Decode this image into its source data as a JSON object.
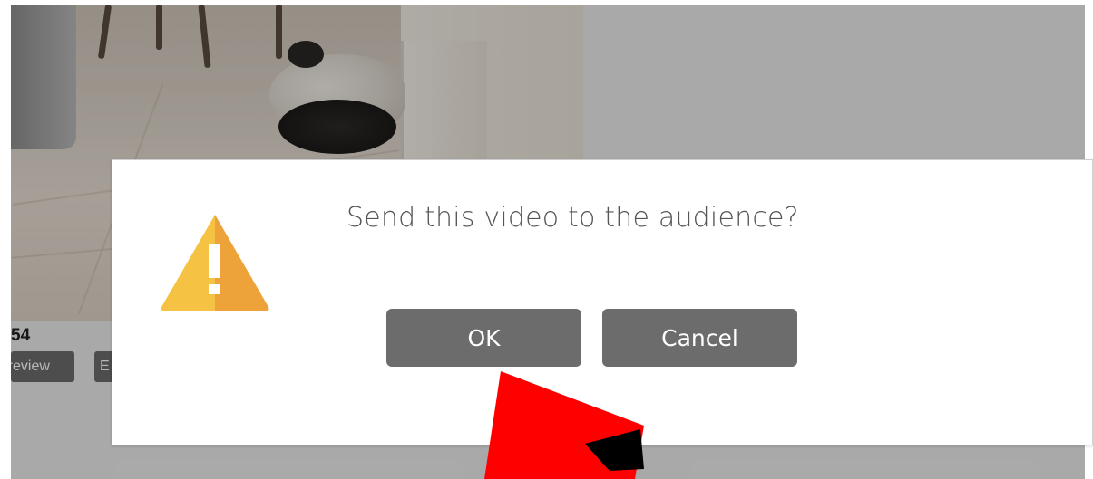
{
  "video": {
    "count_label": "54",
    "preview_label": "Preview",
    "second_label": "E"
  },
  "dialog": {
    "message": "Send this video to the audience?",
    "ok_label": "OK",
    "cancel_label": "Cancel",
    "icon": "warning-triangle-icon",
    "icon_colors": {
      "left": "#f6c244",
      "right": "#eea23a",
      "mark": "#ffffff"
    }
  },
  "theme": {
    "button_bg": "#6c6c6c",
    "overlay": "rgba(0,0,0,0.28)",
    "pointer_color": "#ff0000"
  }
}
